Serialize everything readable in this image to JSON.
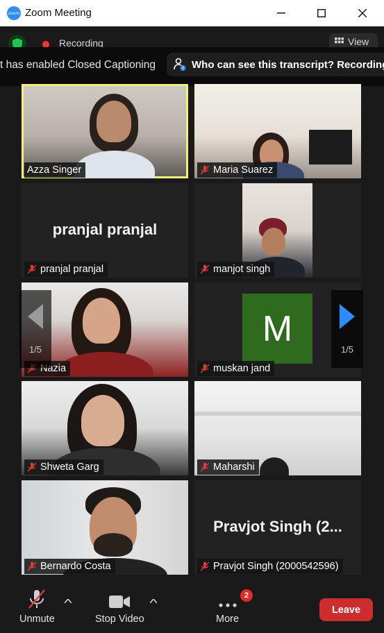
{
  "window": {
    "app_icon_text": "zoom",
    "title": "Zoom Meeting"
  },
  "meeting": {
    "recording_label": "Recording",
    "view_label": "View",
    "caption_text": "t has enabled Closed Captioning",
    "transcript_notice": "Who can see this transcript? Recording"
  },
  "participants": [
    {
      "name": "Azza Singer",
      "muted": false,
      "active_speaker": true,
      "video": "camera"
    },
    {
      "name": "Maria Suarez",
      "muted": true,
      "video": "camera"
    },
    {
      "name": "pranjal pranjal",
      "muted": true,
      "video": "off",
      "display_name": "pranjal pranjal"
    },
    {
      "name": "manjot singh",
      "muted": true,
      "video": "camera"
    },
    {
      "name": "Nazia",
      "muted": true,
      "video": "camera"
    },
    {
      "name": "muskan jand",
      "muted": true,
      "video": "avatar",
      "avatar_letter": "M",
      "avatar_color": "#2f6b1e"
    },
    {
      "name": "Shweta Garg",
      "muted": true,
      "video": "camera"
    },
    {
      "name": "Maharshi",
      "muted": true,
      "video": "camera"
    },
    {
      "name": "Bernardo Costa",
      "muted": true,
      "video": "camera"
    },
    {
      "name": "Pravjot Singh (2000542596)",
      "muted": true,
      "video": "off",
      "display_name": "Pravjot Singh (2..."
    }
  ],
  "pagination": {
    "left_page": "1/5",
    "right_page": "1/5"
  },
  "toolbar": {
    "unmute_label": "Unmute",
    "stop_video_label": "Stop Video",
    "more_label": "More",
    "more_badge": "2",
    "leave_label": "Leave"
  },
  "colors": {
    "active_speaker_border": "#f1f17a",
    "leave_button": "#cc2d2d",
    "badge": "#e02b2b",
    "accent_blue": "#2d8cff",
    "muted_red": "#e03a3a"
  }
}
